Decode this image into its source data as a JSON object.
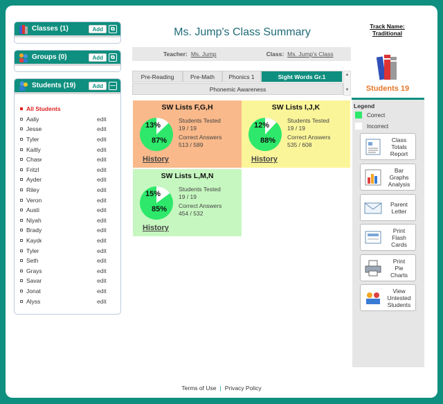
{
  "sidebar": {
    "classes": {
      "label": "Classes",
      "count": "(1)",
      "add": "Add"
    },
    "groups": {
      "label": "Groups",
      "count": "(0)",
      "add": "Add"
    },
    "students": {
      "label": "Students",
      "count": "(19)",
      "add": "Add",
      "collapse": "—",
      "all": "All Students",
      "edit": "edit",
      "names": [
        "Aaliy",
        "Jesse",
        "Tyler",
        "Kaitly",
        "Chase",
        "Fritzl",
        "Ayden",
        "Riley",
        "Veron",
        "Austi",
        "Niyah",
        "Brady",
        "Kayde",
        "Tyler",
        "Seth",
        "Grays",
        "Savan",
        "Jonat",
        "Alyss"
      ]
    }
  },
  "header": {
    "title": "Ms. Jump's Class Summary",
    "teacher_label": "Teacher:",
    "teacher": "Ms. Jump",
    "class_label": "Class:",
    "class": "Ms. Jump's Class"
  },
  "tabs": {
    "items": [
      "Pre-Reading",
      "Pre-Math",
      "Phonics 1",
      "Sight Words Gr.1"
    ],
    "active": "Sight Words Gr.1",
    "second_row": "Phonemic Awareness"
  },
  "cards": [
    {
      "title": "SW Lists F,G,H",
      "incorrect_pct": "13%",
      "correct_pct": "87%",
      "tested_label": "Students Tested",
      "tested": "19 / 19",
      "answers_label": "Correct Answers",
      "answers": "513 / 589",
      "history": "History",
      "correct_fraction": 0.87,
      "color": "#f9b98a"
    },
    {
      "title": "SW Lists I,J,K",
      "incorrect_pct": "12%",
      "correct_pct": "88%",
      "tested_label": "Students Tested",
      "tested": "19 / 19",
      "answers_label": "Correct Answers",
      "answers": "535 / 608",
      "history": "History",
      "correct_fraction": 0.88,
      "color": "#fbf59a"
    },
    {
      "title": "SW Lists L,M,N",
      "incorrect_pct": "15%",
      "correct_pct": "85%",
      "tested_label": "Students Tested",
      "tested": "19 / 19",
      "answers_label": "Correct Answers",
      "answers": "454 / 532",
      "history": "History",
      "correct_fraction": 0.85,
      "color": "#c6f7c0"
    }
  ],
  "right": {
    "track_label": "Track Name:",
    "track": "Traditional",
    "students": "Students 19",
    "legend_title": "Legend",
    "legend_correct": "Correct",
    "legend_incorrect": "Incorrect",
    "correct_color": "#2ee86b",
    "incorrect_color": "#ffffff",
    "actions": [
      {
        "icon": "report-icon",
        "lines": [
          "Class",
          "Totals",
          "Report"
        ]
      },
      {
        "icon": "bar-graph-icon",
        "lines": [
          "Bar",
          "Graphs",
          "Analysis"
        ]
      },
      {
        "icon": "envelope-icon",
        "lines": [
          "Parent",
          "Letter"
        ]
      },
      {
        "icon": "flashcard-icon",
        "lines": [
          "Print",
          "Flash",
          "Cards"
        ]
      },
      {
        "icon": "printer-icon",
        "lines": [
          "Print",
          "Pie",
          "Charts"
        ]
      },
      {
        "icon": "untested-students-icon",
        "lines": [
          "View",
          "Untested",
          "Students"
        ]
      }
    ]
  },
  "footer": {
    "terms": "Terms of Use",
    "privacy": "Privacy Policy",
    "sep": "|"
  }
}
